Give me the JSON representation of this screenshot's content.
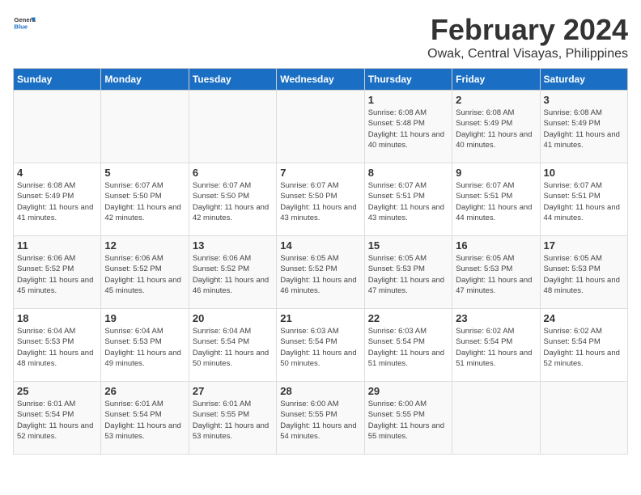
{
  "header": {
    "logo_general": "General",
    "logo_blue": "Blue",
    "title": "February 2024",
    "subtitle": "Owak, Central Visayas, Philippines"
  },
  "columns": [
    "Sunday",
    "Monday",
    "Tuesday",
    "Wednesday",
    "Thursday",
    "Friday",
    "Saturday"
  ],
  "weeks": [
    [
      {
        "day": "",
        "info": ""
      },
      {
        "day": "",
        "info": ""
      },
      {
        "day": "",
        "info": ""
      },
      {
        "day": "",
        "info": ""
      },
      {
        "day": "1",
        "info": "Sunrise: 6:08 AM\nSunset: 5:48 PM\nDaylight: 11 hours and 40 minutes."
      },
      {
        "day": "2",
        "info": "Sunrise: 6:08 AM\nSunset: 5:49 PM\nDaylight: 11 hours and 40 minutes."
      },
      {
        "day": "3",
        "info": "Sunrise: 6:08 AM\nSunset: 5:49 PM\nDaylight: 11 hours and 41 minutes."
      }
    ],
    [
      {
        "day": "4",
        "info": "Sunrise: 6:08 AM\nSunset: 5:49 PM\nDaylight: 11 hours and 41 minutes."
      },
      {
        "day": "5",
        "info": "Sunrise: 6:07 AM\nSunset: 5:50 PM\nDaylight: 11 hours and 42 minutes."
      },
      {
        "day": "6",
        "info": "Sunrise: 6:07 AM\nSunset: 5:50 PM\nDaylight: 11 hours and 42 minutes."
      },
      {
        "day": "7",
        "info": "Sunrise: 6:07 AM\nSunset: 5:50 PM\nDaylight: 11 hours and 43 minutes."
      },
      {
        "day": "8",
        "info": "Sunrise: 6:07 AM\nSunset: 5:51 PM\nDaylight: 11 hours and 43 minutes."
      },
      {
        "day": "9",
        "info": "Sunrise: 6:07 AM\nSunset: 5:51 PM\nDaylight: 11 hours and 44 minutes."
      },
      {
        "day": "10",
        "info": "Sunrise: 6:07 AM\nSunset: 5:51 PM\nDaylight: 11 hours and 44 minutes."
      }
    ],
    [
      {
        "day": "11",
        "info": "Sunrise: 6:06 AM\nSunset: 5:52 PM\nDaylight: 11 hours and 45 minutes."
      },
      {
        "day": "12",
        "info": "Sunrise: 6:06 AM\nSunset: 5:52 PM\nDaylight: 11 hours and 45 minutes."
      },
      {
        "day": "13",
        "info": "Sunrise: 6:06 AM\nSunset: 5:52 PM\nDaylight: 11 hours and 46 minutes."
      },
      {
        "day": "14",
        "info": "Sunrise: 6:05 AM\nSunset: 5:52 PM\nDaylight: 11 hours and 46 minutes."
      },
      {
        "day": "15",
        "info": "Sunrise: 6:05 AM\nSunset: 5:53 PM\nDaylight: 11 hours and 47 minutes."
      },
      {
        "day": "16",
        "info": "Sunrise: 6:05 AM\nSunset: 5:53 PM\nDaylight: 11 hours and 47 minutes."
      },
      {
        "day": "17",
        "info": "Sunrise: 6:05 AM\nSunset: 5:53 PM\nDaylight: 11 hours and 48 minutes."
      }
    ],
    [
      {
        "day": "18",
        "info": "Sunrise: 6:04 AM\nSunset: 5:53 PM\nDaylight: 11 hours and 48 minutes."
      },
      {
        "day": "19",
        "info": "Sunrise: 6:04 AM\nSunset: 5:53 PM\nDaylight: 11 hours and 49 minutes."
      },
      {
        "day": "20",
        "info": "Sunrise: 6:04 AM\nSunset: 5:54 PM\nDaylight: 11 hours and 50 minutes."
      },
      {
        "day": "21",
        "info": "Sunrise: 6:03 AM\nSunset: 5:54 PM\nDaylight: 11 hours and 50 minutes."
      },
      {
        "day": "22",
        "info": "Sunrise: 6:03 AM\nSunset: 5:54 PM\nDaylight: 11 hours and 51 minutes."
      },
      {
        "day": "23",
        "info": "Sunrise: 6:02 AM\nSunset: 5:54 PM\nDaylight: 11 hours and 51 minutes."
      },
      {
        "day": "24",
        "info": "Sunrise: 6:02 AM\nSunset: 5:54 PM\nDaylight: 11 hours and 52 minutes."
      }
    ],
    [
      {
        "day": "25",
        "info": "Sunrise: 6:01 AM\nSunset: 5:54 PM\nDaylight: 11 hours and 52 minutes."
      },
      {
        "day": "26",
        "info": "Sunrise: 6:01 AM\nSunset: 5:54 PM\nDaylight: 11 hours and 53 minutes."
      },
      {
        "day": "27",
        "info": "Sunrise: 6:01 AM\nSunset: 5:55 PM\nDaylight: 11 hours and 53 minutes."
      },
      {
        "day": "28",
        "info": "Sunrise: 6:00 AM\nSunset: 5:55 PM\nDaylight: 11 hours and 54 minutes."
      },
      {
        "day": "29",
        "info": "Sunrise: 6:00 AM\nSunset: 5:55 PM\nDaylight: 11 hours and 55 minutes."
      },
      {
        "day": "",
        "info": ""
      },
      {
        "day": "",
        "info": ""
      }
    ]
  ]
}
